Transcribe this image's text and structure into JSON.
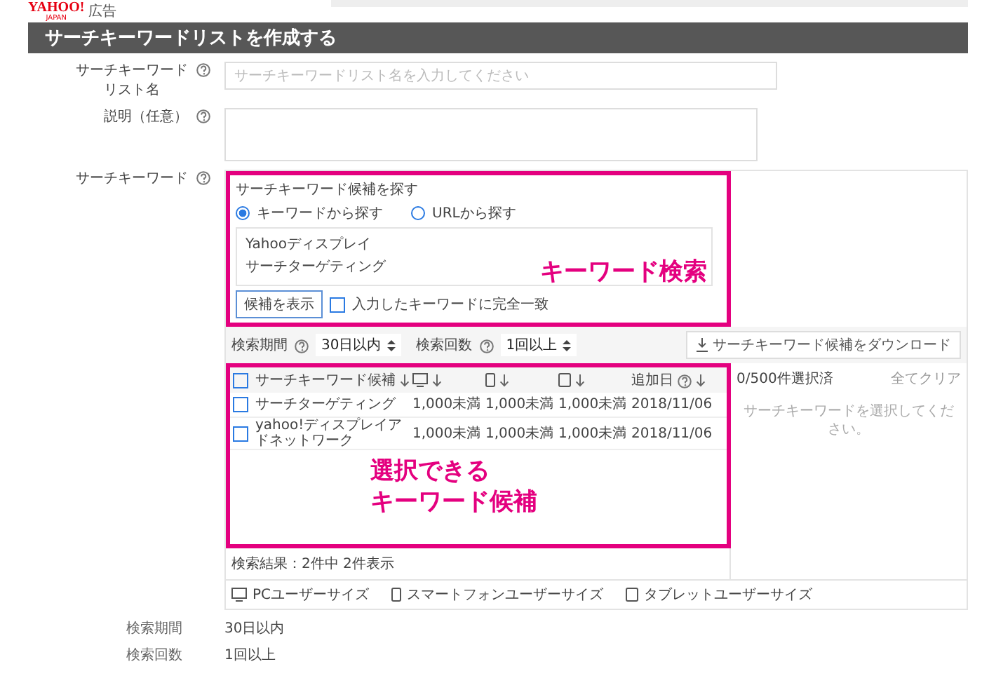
{
  "logo": {
    "brand": "YAHOO!",
    "sub": "JAPAN",
    "label": "広告"
  },
  "header": {
    "title": "サーチキーワードリストを作成する"
  },
  "fields": [
    {
      "kind": "input",
      "label": [
        "サーチキーワード",
        "リスト名"
      ],
      "placeholder": "サーチキーワードリスト名を入力してください"
    },
    {
      "kind": "textarea",
      "label": [
        "説明（任意）"
      ]
    }
  ],
  "keyword_section": {
    "label": "サーチキーワード",
    "search": {
      "title": "サーチキーワード候補を探す",
      "options": [
        {
          "label": "キーワードから探す",
          "selected": true
        },
        {
          "label": "URLから探す",
          "selected": false
        }
      ],
      "keywords": [
        "Yahooディスプレイ",
        "サーチターゲティング"
      ],
      "button": "候補を表示",
      "exact_match": {
        "label": "入力したキーワードに完全一致",
        "checked": false
      },
      "annotation": "キーワード検索"
    },
    "filters": [
      {
        "label": "検索期間",
        "value": "30日以内"
      },
      {
        "label": "検索回数",
        "value": "1回以上"
      }
    ],
    "download_button": "サーチキーワード候補をダウンロード",
    "table": {
      "all_checked": false,
      "columns": [
        {
          "kind": "keyword",
          "label": "サーチキーワード候補"
        },
        {
          "kind": "pc"
        },
        {
          "kind": "smartphone"
        },
        {
          "kind": "tablet"
        },
        {
          "kind": "date",
          "label": "追加日"
        }
      ],
      "rows": [
        {
          "checked": false,
          "cells": [
            "サーチターゲティング",
            "1,000未満",
            "1,000未満",
            "1,000未満",
            "2018/11/06"
          ]
        },
        {
          "checked": false,
          "cells": [
            "yahoo!ディスプレイアドネットワーク",
            "1,000未満",
            "1,000未満",
            "1,000未満",
            "2018/11/06"
          ]
        }
      ],
      "annotation": [
        "選択できる",
        "キーワード候補"
      ]
    },
    "selection": {
      "count": "0/500件選択済",
      "clear": "全てクリア",
      "empty": "サーチキーワードを選択してください。"
    },
    "results": "検索結果：2件中 2件表示",
    "legend": [
      {
        "kind": "pc",
        "label": "PCユーザーサイズ"
      },
      {
        "kind": "smartphone",
        "label": "スマートフォンユーザーサイズ"
      },
      {
        "kind": "tablet",
        "label": "タブレットユーザーサイズ"
      }
    ]
  },
  "summary": [
    {
      "label": "検索期間",
      "value": "30日以内"
    },
    {
      "label": "検索回数",
      "value": "1回以上"
    }
  ]
}
